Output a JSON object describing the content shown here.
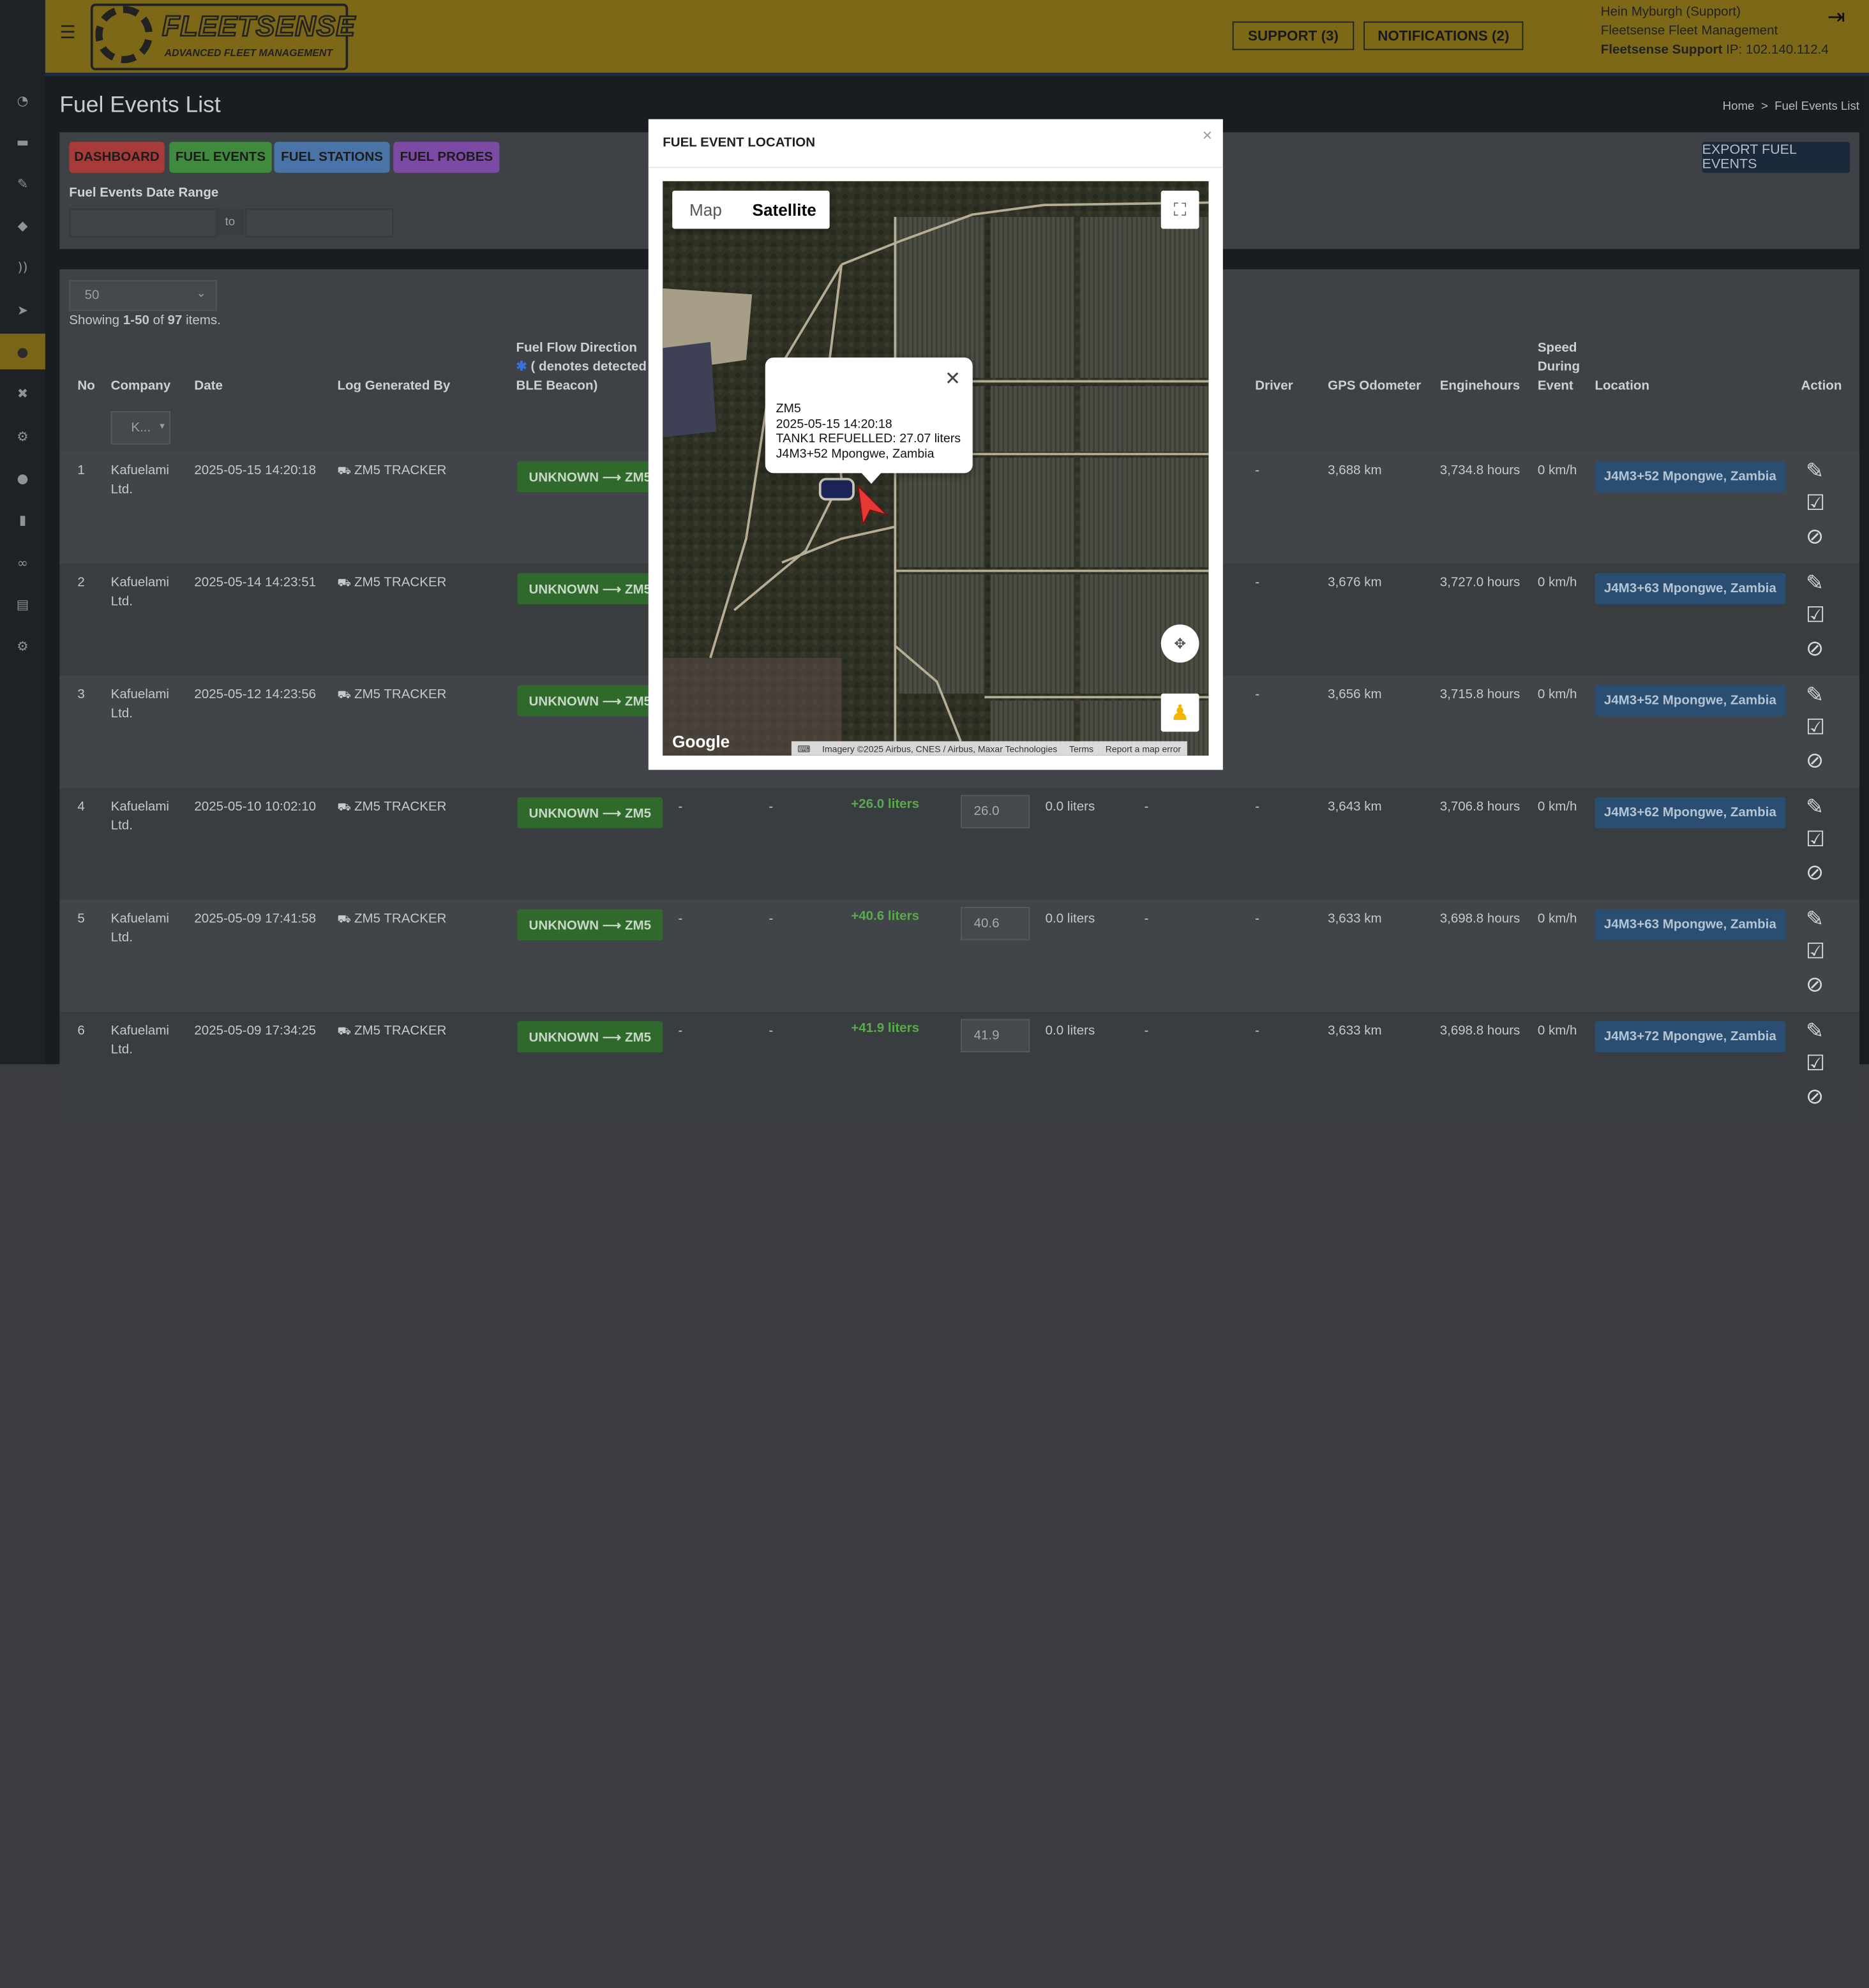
{
  "app": {
    "logo_title": "FLEETSENSE",
    "logo_subtitle": "ADVANCED FLEET MANAGEMENT",
    "support_label": "SUPPORT (3)",
    "notifications_label": "NOTIFICATIONS (2)",
    "user_name": "Hein Myburgh (Support)",
    "user_org": "Fleetsense Fleet Management",
    "user_role": "Fleetsense Support",
    "user_ip_label": " IP: 102.140.112.4"
  },
  "sidebar_icons": [
    "dashboard-icon",
    "truck-icon",
    "wrench-icon",
    "tags-icon",
    "rss-icon",
    "location-arrow-icon",
    "fuel-drop-icon",
    "tools-icon",
    "steering-icon",
    "user-icon",
    "chart-icon",
    "link-icon",
    "book-icon",
    "settings-icon"
  ],
  "page": {
    "title": "Fuel Events List",
    "breadcrumb_home": "Home",
    "breadcrumb_sep": ">",
    "breadcrumb_current": "Fuel Events List"
  },
  "toolbar": {
    "dashboard": "DASHBOARD",
    "fuel_events": "FUEL EVENTS",
    "fuel_stations": "FUEL STATIONS",
    "fuel_probes": "FUEL PROBES",
    "export": "EXPORT FUEL EVENTS",
    "date_range_label": "Fuel Events Date Range",
    "date_to": "to"
  },
  "list": {
    "page_size": "50",
    "showing_prefix": "Showing ",
    "showing_range": "1-50",
    "showing_mid": " of ",
    "showing_total": "97",
    "showing_suffix": " items.",
    "company_filter": "K...",
    "headers": {
      "no": "No",
      "company": "Company",
      "date": "Date",
      "log_generated_by": "Log Generated By",
      "fuel_flow_line1": "Fuel Flow Direction",
      "fuel_flow_line2": "( denotes detected",
      "fuel_flow_line3": "BLE Beacon)",
      "driver": "Driver",
      "gps_odometer": "GPS Odometer",
      "enginehours": "Enginehours",
      "speed_line1": "Speed",
      "speed_line2": "During",
      "speed_line3": "Event",
      "location": "Location",
      "action": "Action"
    },
    "rows": [
      {
        "no": "1",
        "company_l1": "Kafuelami",
        "company_l2": "Ltd.",
        "date": "2025-05-15 14:20:18",
        "log_by": "ZM5 TRACKER",
        "flow": "UNKNOWN ⟶ ZM5",
        "col_a": "",
        "col_b": "",
        "litres": "",
        "input": "",
        "col_c": "",
        "col_d": "",
        "driver": "-",
        "odo": "3,688 km",
        "engine": "3,734.8 hours",
        "speed": "0 km/h",
        "location": "J4M3+52 Mpongwe, Zambia"
      },
      {
        "no": "2",
        "company_l1": "Kafuelami",
        "company_l2": "Ltd.",
        "date": "2025-05-14 14:23:51",
        "log_by": "ZM5 TRACKER",
        "flow": "UNKNOWN ⟶ ZM5",
        "col_a": "",
        "col_b": "",
        "litres": "",
        "input": "",
        "col_c": "",
        "col_d": "",
        "driver": "-",
        "odo": "3,676 km",
        "engine": "3,727.0 hours",
        "speed": "0 km/h",
        "location": "J4M3+63 Mpongwe, Zambia"
      },
      {
        "no": "3",
        "company_l1": "Kafuelami",
        "company_l2": "Ltd.",
        "date": "2025-05-12 14:23:56",
        "log_by": "ZM5 TRACKER",
        "flow": "UNKNOWN ⟶ ZM5",
        "col_a": "",
        "col_b": "",
        "litres": "",
        "input": "",
        "col_c": "",
        "col_d": "",
        "driver": "-",
        "odo": "3,656 km",
        "engine": "3,715.8 hours",
        "speed": "0 km/h",
        "location": "J4M3+52 Mpongwe, Zambia"
      },
      {
        "no": "4",
        "company_l1": "Kafuelami",
        "company_l2": "Ltd.",
        "date": "2025-05-10 10:02:10",
        "log_by": "ZM5 TRACKER",
        "flow": "UNKNOWN ⟶ ZM5",
        "col_a": "-",
        "col_b": "-",
        "litres": "+26.0 liters",
        "input": "26.0",
        "col_c": "0.0 liters",
        "col_d": "-",
        "driver": "-",
        "odo": "3,643 km",
        "engine": "3,706.8 hours",
        "speed": "0 km/h",
        "location": "J4M3+62 Mpongwe, Zambia"
      },
      {
        "no": "5",
        "company_l1": "Kafuelami",
        "company_l2": "Ltd.",
        "date": "2025-05-09 17:41:58",
        "log_by": "ZM5 TRACKER",
        "flow": "UNKNOWN ⟶ ZM5",
        "col_a": "-",
        "col_b": "-",
        "litres": "+40.6 liters",
        "input": "40.6",
        "col_c": "0.0 liters",
        "col_d": "-",
        "driver": "-",
        "odo": "3,633 km",
        "engine": "3,698.8 hours",
        "speed": "0 km/h",
        "location": "J4M3+63 Mpongwe, Zambia"
      },
      {
        "no": "6",
        "company_l1": "Kafuelami",
        "company_l2": "Ltd.",
        "date": "2025-05-09 17:34:25",
        "log_by": "ZM5 TRACKER",
        "flow": "UNKNOWN ⟶ ZM5",
        "col_a": "-",
        "col_b": "-",
        "litres": "+41.9 liters",
        "input": "41.9",
        "col_c": "0.0 liters",
        "col_d": "-",
        "driver": "-",
        "odo": "3,633 km",
        "engine": "3,698.8 hours",
        "speed": "0 km/h",
        "location": "J4M3+72 Mpongwe, Zambia"
      }
    ]
  },
  "modal": {
    "title": "FUEL EVENT LOCATION",
    "close": "×",
    "map_tab": "Map",
    "satellite_tab": "Satellite",
    "info_vehicle": "ZM5",
    "info_datetime": "2025-05-15 14:20:18",
    "info_event": "TANK1 REFUELLED: 27.07 liters",
    "info_location": "J4M3+52 Mpongwe, Zambia",
    "google_logo": "Google",
    "attribution": "Imagery ©2025 Airbus, CNES / Airbus, Maxar Technologies",
    "terms": "Terms",
    "report": "Report a map error"
  },
  "colors": {
    "topbar": "#7c6817",
    "dashboard_btn": "#a83a3a",
    "fuel_events_btn": "#3f8a3c",
    "fuel_stations_btn": "#4a74a8",
    "fuel_probes_btn": "#7b4aa4",
    "green_btn": "#2f6a2c",
    "blue_btn": "#2a4e72",
    "marker": "#e53935"
  }
}
